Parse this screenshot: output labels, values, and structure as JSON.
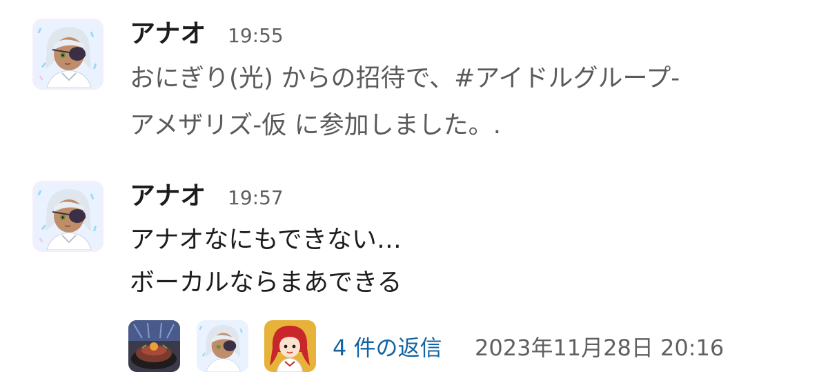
{
  "messages": [
    {
      "author": "アナオ",
      "time": "19:55",
      "lines": [
        "おにぎり(光) からの招待で、#アイドルグループ-",
        "アメザリズ-仮 に参加しました。."
      ],
      "avatar_icon": "white-haired-eyepatch-avatar"
    },
    {
      "author": "アナオ",
      "time": "19:57",
      "lines": [
        "アナオなにもできない…",
        "ボーカルならまあできる"
      ],
      "avatar_icon": "white-haired-eyepatch-avatar"
    }
  ],
  "thread": {
    "participants": [
      {
        "icon": "food-bowl-avatar"
      },
      {
        "icon": "white-haired-eyepatch-avatar"
      },
      {
        "icon": "red-haired-girl-avatar"
      }
    ],
    "reply_label": "4 件の返信",
    "last_reply": "2023年11月28日 20:16"
  },
  "colors": {
    "text": "#1d1c1d",
    "muted": "#616061",
    "link": "#1264a3",
    "background": "#ffffff"
  }
}
